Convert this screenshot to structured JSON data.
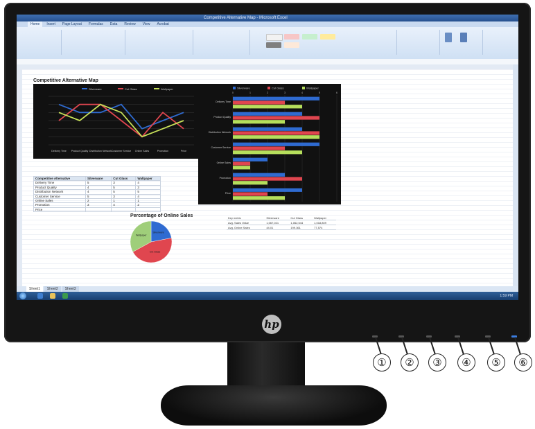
{
  "excel": {
    "window_title": "Competitive Alternative Map - Microsoft Excel",
    "ribbon_tabs": [
      "Home",
      "Insert",
      "Page Layout",
      "Formulas",
      "Data",
      "Review",
      "View",
      "Acrobat"
    ],
    "sheet_title": "Competitive Alternative Map",
    "sheet_tabs": [
      "Sheet1",
      "Sheet2",
      "Sheet3"
    ],
    "clock": "1:59 PM",
    "line_chart": {
      "legend": [
        "Silverware",
        "Cut Glass",
        "Wallpaper"
      ],
      "categories": [
        "Delivery Time",
        "Product Quality",
        "Distribution Network",
        "Customer Service",
        "Online Sales",
        "Promotion",
        "Price"
      ]
    },
    "bar_chart": {
      "legend": [
        "Silverware",
        "Cut Glass",
        "Wallpaper"
      ],
      "categories": [
        "Delivery Time",
        "Product Quality",
        "Distribution Network",
        "Customer Service",
        "Online Sales",
        "Promotion",
        "Price"
      ]
    },
    "table": {
      "headers": [
        "Competitive Alternative",
        "Silverware",
        "Cut Glass",
        "Wallpaper"
      ],
      "rows": [
        [
          "Delivery Time",
          "5",
          "3",
          "4"
        ],
        [
          "Product Quality",
          "4",
          "5",
          "3"
        ],
        [
          "Distribution Network",
          "4",
          "5",
          "5"
        ],
        [
          "Customer Service",
          "5",
          "3",
          "4"
        ],
        [
          "Online Sales",
          "2",
          "1",
          "1"
        ],
        [
          "Promotion",
          "3",
          "4",
          "2"
        ],
        [
          "Price",
          "",
          "",
          ""
        ]
      ]
    },
    "pie": {
      "title": "Percentage of Online Sales",
      "slices": [
        {
          "label": "Silverware",
          "value": 22,
          "color": "#2f6bd1"
        },
        {
          "label": "Cut Glass",
          "value": 45,
          "color": "#e0464f"
        },
        {
          "label": "Wallpaper",
          "value": 33,
          "color": "#9fce7a"
        }
      ]
    },
    "summary": {
      "headers": [
        "Key metric",
        "Silverware",
        "Cut Glass",
        "Wallpaper"
      ],
      "rows": [
        [
          "Avg. Sales Value",
          "1,067,021",
          "1,062,544",
          "1,018,809"
        ],
        [
          "Avg. Online Sales",
          "44.01",
          "199.361",
          "77,574"
        ]
      ]
    }
  },
  "hardware": {
    "brand": "hp",
    "callouts": [
      "①",
      "②",
      "③",
      "④",
      "⑤",
      "⑥"
    ]
  },
  "colors": {
    "series": [
      "#2f6bd1",
      "#e0464f",
      "#c8e25a"
    ],
    "bar_series": [
      "#2f6bd1",
      "#e0464f",
      "#b6df5c"
    ]
  },
  "chart_data": [
    {
      "type": "line",
      "categories": [
        "Delivery Time",
        "Product Quality",
        "Distribution Network",
        "Customer Service",
        "Online Sales",
        "Promotion",
        "Price"
      ],
      "series": [
        {
          "name": "Silverware",
          "values": [
            5,
            4,
            4,
            5,
            2,
            3,
            4
          ]
        },
        {
          "name": "Cut Glass",
          "values": [
            3,
            5,
            5,
            3,
            1,
            4,
            2
          ]
        },
        {
          "name": "Wallpaper",
          "values": [
            4,
            3,
            5,
            4,
            1,
            2,
            3
          ]
        }
      ],
      "ylim": [
        0,
        6
      ],
      "grid": true,
      "legend": "top"
    },
    {
      "type": "bar",
      "orientation": "horizontal",
      "categories": [
        "Delivery Time",
        "Product Quality",
        "Distribution Network",
        "Customer Service",
        "Online Sales",
        "Promotion",
        "Price"
      ],
      "series": [
        {
          "name": "Silverware",
          "values": [
            5,
            4,
            4,
            5,
            2,
            3,
            4
          ]
        },
        {
          "name": "Cut Glass",
          "values": [
            3,
            5,
            5,
            3,
            1,
            4,
            2
          ]
        },
        {
          "name": "Wallpaper",
          "values": [
            4,
            3,
            5,
            4,
            1,
            2,
            3
          ]
        }
      ],
      "xlim": [
        0,
        6
      ],
      "grid": true,
      "legend": "top"
    },
    {
      "type": "pie",
      "title": "Percentage of Online Sales",
      "categories": [
        "Silverware",
        "Cut Glass",
        "Wallpaper"
      ],
      "values": [
        22,
        45,
        33
      ]
    }
  ]
}
